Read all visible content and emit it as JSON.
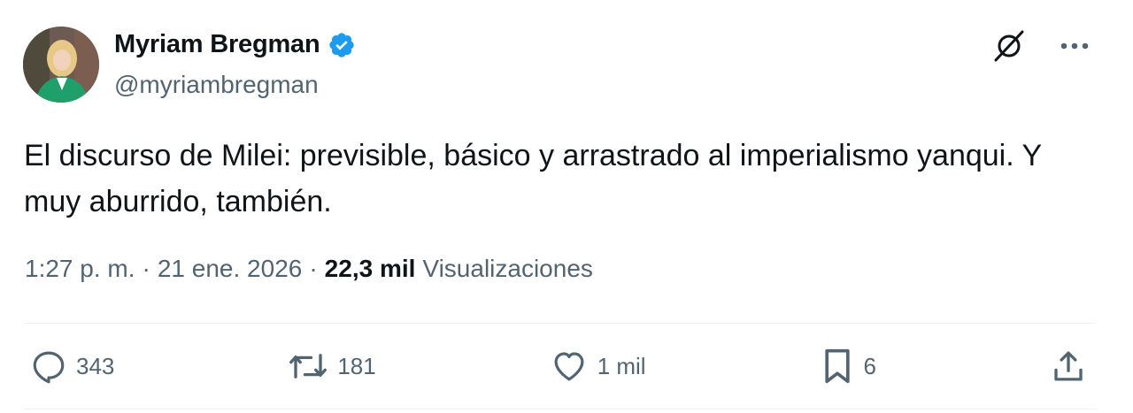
{
  "author": {
    "display_name": "Myriam Bregman",
    "handle": "@myriambregman",
    "verified_color": "#1d9bf0"
  },
  "tweet": {
    "text": "El discurso de Milei: previsible, básico y arrastrado al imperialismo yanqui. Y\nmuy aburrido, también."
  },
  "meta": {
    "time": "1:27 p. m.",
    "sep1": "·",
    "date": "21 ene. 2026",
    "sep2": "·",
    "views_count": "22,3 mil",
    "views_label": "Visualizaciones"
  },
  "actions": {
    "replies": "343",
    "reposts": "181",
    "likes": "1 mil",
    "bookmarks": "6"
  },
  "icons": {
    "grok": "grok-icon",
    "more": "more-icon",
    "reply": "reply-icon",
    "repost": "repost-icon",
    "like": "heart-icon",
    "bookmark": "bookmark-icon",
    "share": "share-icon"
  },
  "colors": {
    "text": "#0f1419",
    "secondary": "#536471",
    "accent": "#1d9bf0"
  }
}
